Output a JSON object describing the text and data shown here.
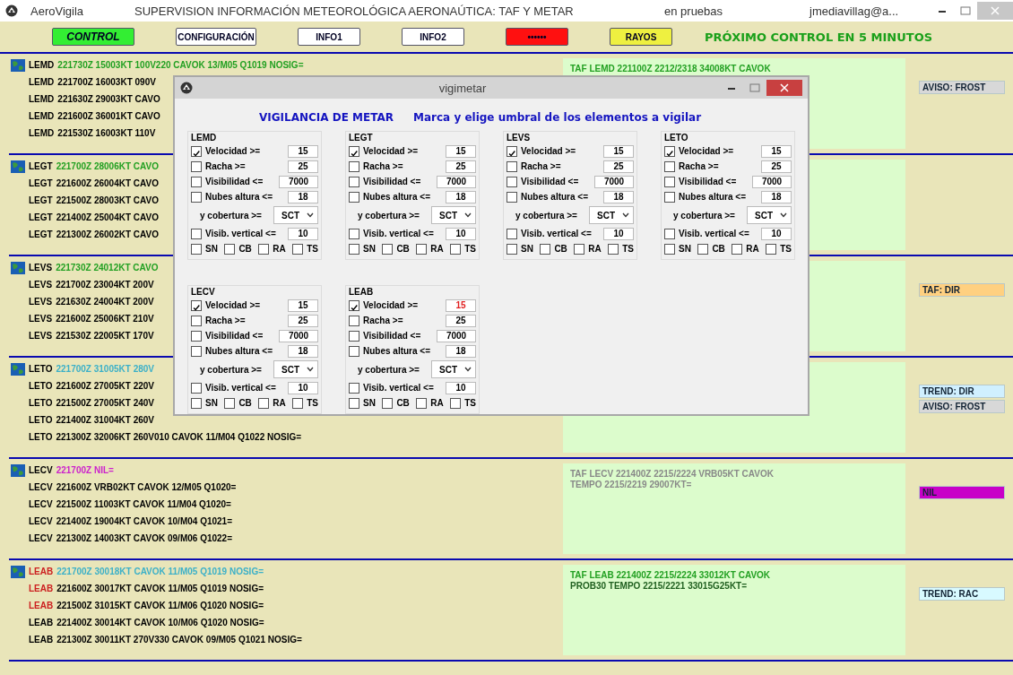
{
  "window": {
    "app_name": "AeroVigila",
    "title": "SUPERVISION INFORMACIÓN METEOROLÓGICA AERONAÚTICA: TAF Y METAR",
    "status": "en pruebas",
    "user": "jmediavillag@a..."
  },
  "toolbar": {
    "buttons": [
      {
        "label": "CONTROL",
        "color": "#33ee33"
      },
      {
        "label": "CONFIGURACIÓN",
        "color": "#ffffff"
      },
      {
        "label": "INFO1",
        "color": "#ffffff"
      },
      {
        "label": "INFO2",
        "color": "#ffffff"
      },
      {
        "label": "••••••",
        "color": "#ff1010"
      },
      {
        "label": "RAYOS",
        "color": "#eef040"
      }
    ],
    "status_text": "PRÓXIMO CONTROL EN 5 MINUTOS"
  },
  "stations": [
    {
      "metar": [
        {
          "station": "LEMD",
          "station_alert": false,
          "text": "221730Z 15003KT 100V220 CAVOK 13/M05 Q1019 NOSIG=",
          "color": "#22a022"
        },
        {
          "station": "LEMD",
          "station_alert": false,
          "text": "221700Z 16003KT 090V"
        },
        {
          "station": "LEMD",
          "station_alert": false,
          "text": "221630Z 29003KT CAVO"
        },
        {
          "station": "LEMD",
          "station_alert": false,
          "text": "221600Z 36001KT CAVO"
        },
        {
          "station": "LEMD",
          "station_alert": false,
          "text": "221530Z 16003KT 110V"
        }
      ],
      "taf": [
        {
          "text": "TAF LEMD 221100Z 2212/2318 34008KT CAVOK",
          "color": "#22a022"
        }
      ],
      "alerts": [
        {
          "label": "AVISO: FROST",
          "color": "#d8d8d8"
        }
      ]
    },
    {
      "metar": [
        {
          "station": "LEGT",
          "station_alert": false,
          "text": "221700Z 28006KT CAVO",
          "color": "#22a022"
        },
        {
          "station": "LEGT",
          "station_alert": false,
          "text": "221600Z 26004KT CAVO"
        },
        {
          "station": "LEGT",
          "station_alert": false,
          "text": "221500Z 28003KT CAVO"
        },
        {
          "station": "LEGT",
          "station_alert": false,
          "text": "221400Z 25004KT CAVO"
        },
        {
          "station": "LEGT",
          "station_alert": false,
          "text": "221300Z 26002KT CAVO"
        }
      ]
    },
    {
      "metar": [
        {
          "station": "LEVS",
          "station_alert": false,
          "text": "221730Z 24012KT CAVO",
          "color": "#22a022"
        },
        {
          "station": "LEVS",
          "station_alert": false,
          "text": "221700Z 23004KT 200V"
        },
        {
          "station": "LEVS",
          "station_alert": false,
          "text": "221630Z 24004KT 200V"
        },
        {
          "station": "LEVS",
          "station_alert": false,
          "text": "221600Z 25006KT 210V"
        },
        {
          "station": "LEVS",
          "station_alert": false,
          "text": "221530Z 22005KT 170V"
        }
      ],
      "alerts": [
        {
          "label": "TAF: DIR",
          "color": "#ffd080"
        }
      ]
    },
    {
      "metar": [
        {
          "station": "LETO",
          "station_alert": false,
          "text": "221700Z 31005KT 280V",
          "color": "#3cb0c8"
        },
        {
          "station": "LETO",
          "station_alert": false,
          "text": "221600Z 27005KT 220V"
        },
        {
          "station": "LETO",
          "station_alert": false,
          "text": "221500Z 27005KT 240V"
        },
        {
          "station": "LETO",
          "station_alert": false,
          "text": "221400Z 31004KT 260V"
        },
        {
          "station": "LETO",
          "station_alert": false,
          "text": "221300Z 32006KT 260V010 CAVOK 11/M04 Q1022 NOSIG="
        }
      ],
      "alerts": [
        {
          "label": "TREND: DIR",
          "color": "#d0f0ff"
        },
        {
          "label": "AVISO: FROST",
          "color": "#d8d8d8"
        }
      ]
    },
    {
      "metar": [
        {
          "station": "LECV",
          "station_alert": false,
          "text": "221700Z NIL=",
          "color": "#cc22cc"
        },
        {
          "station": "LECV",
          "station_alert": false,
          "text": "221600Z VRB02KT CAVOK 12/M05 Q1020="
        },
        {
          "station": "LECV",
          "station_alert": false,
          "text": "221500Z 11003KT CAVOK 11/M04 Q1020="
        },
        {
          "station": "LECV",
          "station_alert": false,
          "text": "221400Z 19004KT CAVOK 10/M04 Q1021="
        },
        {
          "station": "LECV",
          "station_alert": false,
          "text": "221300Z 14003KT CAVOK 09/M06 Q1022="
        }
      ],
      "taf": [
        {
          "text": "TAF LECV 221400Z 2215/2224 VRB05KT CAVOK",
          "color": "#888888"
        },
        {
          "text": "TEMPO 2215/2219 29007KT=",
          "color": "#888888"
        }
      ],
      "alerts": [
        {
          "label": "NIL",
          "color": "#c800c8"
        }
      ]
    },
    {
      "metar": [
        {
          "station": "LEAB",
          "station_alert": true,
          "text": "221700Z 30018KT CAVOK 11/M05 Q1019 NOSIG=",
          "color": "#3cb0c8"
        },
        {
          "station": "LEAB",
          "station_alert": true,
          "text": "221600Z 30017KT CAVOK 11/M05 Q1019 NOSIG="
        },
        {
          "station": "LEAB",
          "station_alert": true,
          "text": "221500Z 31015KT CAVOK 11/M06 Q1020 NOSIG="
        },
        {
          "station": "LEAB",
          "station_alert": false,
          "text": "221400Z 30014KT CAVOK 10/M06 Q1020 NOSIG="
        },
        {
          "station": "LEAB",
          "station_alert": false,
          "text": "221300Z 30011KT 270V330 CAVOK 09/M05 Q1021 NOSIG="
        }
      ],
      "taf": [
        {
          "text": "TAF LEAB 221400Z 2215/2224 33012KT CAVOK",
          "color": "#22a022"
        },
        {
          "text": "PROB30 TEMPO 2215/2221 33015G25KT=",
          "color": "#206020"
        }
      ],
      "alerts": [
        {
          "label": "TREND: RAC",
          "color": "#d8faff"
        }
      ]
    }
  ],
  "dialog": {
    "title": "vigimetar",
    "heading": "VIGILANCIA DE METAR",
    "instruction": "Marca y elige umbral de los elementos a vigilar",
    "groups": [
      {
        "name": "LEMD",
        "rows": [
          {
            "kind": "check",
            "label": "Velocidad >=",
            "checked": true,
            "value": "15",
            "alert": false
          },
          {
            "kind": "check",
            "label": "Racha >=",
            "checked": false,
            "value": "25",
            "alert": false
          },
          {
            "kind": "check",
            "label": "Visibilidad <=",
            "checked": false,
            "value": "7000",
            "alert": false
          },
          {
            "kind": "check",
            "label": "Nubes altura <=",
            "checked": false,
            "value": "18",
            "alert": false
          },
          {
            "kind": "select",
            "label": "y cobertura >=",
            "value": "SCT"
          },
          {
            "kind": "check",
            "label": "Visib. vertical <=",
            "checked": false,
            "value": "10",
            "alert": false
          }
        ],
        "flags": [
          {
            "label": "SN",
            "checked": false
          },
          {
            "label": "CB",
            "checked": false
          },
          {
            "label": "RA",
            "checked": false
          },
          {
            "label": "TS",
            "checked": false
          }
        ]
      },
      {
        "name": "LEGT",
        "rows": [
          {
            "kind": "check",
            "label": "Velocidad >=",
            "checked": true,
            "value": "15",
            "alert": false
          },
          {
            "kind": "check",
            "label": "Racha >=",
            "checked": false,
            "value": "25",
            "alert": false
          },
          {
            "kind": "check",
            "label": "Visibilidad <=",
            "checked": false,
            "value": "7000",
            "alert": false
          },
          {
            "kind": "check",
            "label": "Nubes altura <=",
            "checked": false,
            "value": "18",
            "alert": false
          },
          {
            "kind": "select",
            "label": "y cobertura >=",
            "value": "SCT"
          },
          {
            "kind": "check",
            "label": "Visib. vertical <=",
            "checked": false,
            "value": "10",
            "alert": false
          }
        ],
        "flags": [
          {
            "label": "SN",
            "checked": false
          },
          {
            "label": "CB",
            "checked": false
          },
          {
            "label": "RA",
            "checked": false
          },
          {
            "label": "TS",
            "checked": false
          }
        ]
      },
      {
        "name": "LEVS",
        "rows": [
          {
            "kind": "check",
            "label": "Velocidad >=",
            "checked": true,
            "value": "15",
            "alert": false
          },
          {
            "kind": "check",
            "label": "Racha >=",
            "checked": false,
            "value": "25",
            "alert": false
          },
          {
            "kind": "check",
            "label": "Visibilidad <=",
            "checked": false,
            "value": "7000",
            "alert": false
          },
          {
            "kind": "check",
            "label": "Nubes altura <=",
            "checked": false,
            "value": "18",
            "alert": false
          },
          {
            "kind": "select",
            "label": "y cobertura >=",
            "value": "SCT"
          },
          {
            "kind": "check",
            "label": "Visib. vertical <=",
            "checked": false,
            "value": "10",
            "alert": false
          }
        ],
        "flags": [
          {
            "label": "SN",
            "checked": false
          },
          {
            "label": "CB",
            "checked": false
          },
          {
            "label": "RA",
            "checked": false
          },
          {
            "label": "TS",
            "checked": false
          }
        ]
      },
      {
        "name": "LETO",
        "rows": [
          {
            "kind": "check",
            "label": "Velocidad >=",
            "checked": true,
            "value": "15",
            "alert": false
          },
          {
            "kind": "check",
            "label": "Racha >=",
            "checked": false,
            "value": "25",
            "alert": false
          },
          {
            "kind": "check",
            "label": "Visibilidad <=",
            "checked": false,
            "value": "7000",
            "alert": false
          },
          {
            "kind": "check",
            "label": "Nubes altura <=",
            "checked": false,
            "value": "18",
            "alert": false
          },
          {
            "kind": "select",
            "label": "y cobertura >=",
            "value": "SCT"
          },
          {
            "kind": "check",
            "label": "Visib. vertical <=",
            "checked": false,
            "value": "10",
            "alert": false
          }
        ],
        "flags": [
          {
            "label": "SN",
            "checked": false
          },
          {
            "label": "CB",
            "checked": false
          },
          {
            "label": "RA",
            "checked": false
          },
          {
            "label": "TS",
            "checked": false
          }
        ]
      },
      {
        "name": "LECV",
        "rows": [
          {
            "kind": "check",
            "label": "Velocidad >=",
            "checked": true,
            "value": "15",
            "alert": false
          },
          {
            "kind": "check",
            "label": "Racha >=",
            "checked": false,
            "value": "25",
            "alert": false
          },
          {
            "kind": "check",
            "label": "Visibilidad <=",
            "checked": false,
            "value": "7000",
            "alert": false
          },
          {
            "kind": "check",
            "label": "Nubes altura <=",
            "checked": false,
            "value": "18",
            "alert": false
          },
          {
            "kind": "select",
            "label": "y cobertura >=",
            "value": "SCT"
          },
          {
            "kind": "check",
            "label": "Visib. vertical <=",
            "checked": false,
            "value": "10",
            "alert": false
          }
        ],
        "flags": [
          {
            "label": "SN",
            "checked": false
          },
          {
            "label": "CB",
            "checked": false
          },
          {
            "label": "RA",
            "checked": false
          },
          {
            "label": "TS",
            "checked": false
          }
        ]
      },
      {
        "name": "LEAB",
        "rows": [
          {
            "kind": "check",
            "label": "Velocidad >=",
            "checked": true,
            "value": "15",
            "alert": true
          },
          {
            "kind": "check",
            "label": "Racha >=",
            "checked": false,
            "value": "25",
            "alert": false
          },
          {
            "kind": "check",
            "label": "Visibilidad <=",
            "checked": false,
            "value": "7000",
            "alert": false
          },
          {
            "kind": "check",
            "label": "Nubes altura <=",
            "checked": false,
            "value": "18",
            "alert": false
          },
          {
            "kind": "select",
            "label": "y cobertura >=",
            "value": "SCT"
          },
          {
            "kind": "check",
            "label": "Visib. vertical <=",
            "checked": false,
            "value": "10",
            "alert": false
          }
        ],
        "flags": [
          {
            "label": "SN",
            "checked": false
          },
          {
            "label": "CB",
            "checked": false
          },
          {
            "label": "RA",
            "checked": false
          },
          {
            "label": "TS",
            "checked": false
          }
        ]
      }
    ]
  }
}
